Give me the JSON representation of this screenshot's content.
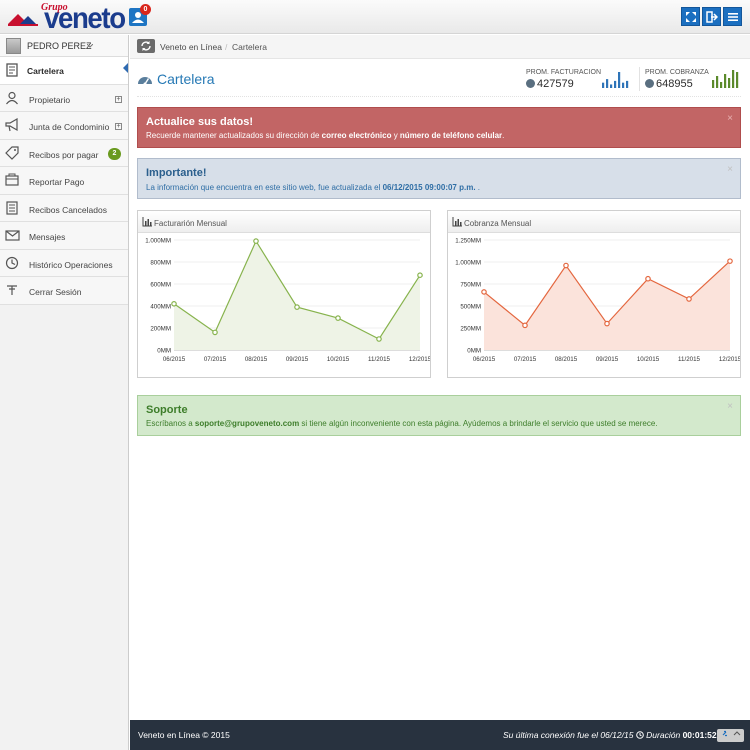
{
  "header": {
    "logo_small": "Grupo",
    "logo_main": "veneto",
    "notification_count": "0",
    "buttons": [
      "fullscreen-icon",
      "logout-icon",
      "menu-icon"
    ]
  },
  "sidebar": {
    "user_name": "PEDRO PEREZ",
    "items": [
      {
        "label": "Cartelera",
        "icon": "board-icon",
        "active": true
      },
      {
        "label": "Propietario",
        "icon": "user-icon",
        "toggle": "+"
      },
      {
        "label": "Junta de Condominio",
        "icon": "megaphone-icon",
        "toggle": "+"
      },
      {
        "label": "Recibos por pagar",
        "icon": "tags-icon",
        "badge": "2"
      },
      {
        "label": "Reportar Pago",
        "icon": "payment-icon"
      },
      {
        "label": "Recibos Cancelados",
        "icon": "receipts-icon"
      },
      {
        "label": "Mensajes",
        "icon": "envelope-icon"
      },
      {
        "label": "Histórico Operaciones",
        "icon": "clock-icon"
      },
      {
        "label": "Cerrar Sesión",
        "icon": "signout-icon"
      }
    ]
  },
  "breadcrumb": {
    "link": "Veneto en Línea",
    "separator": "/",
    "current": "Cartelera"
  },
  "page": {
    "title": "Cartelera",
    "stats": [
      {
        "title": "PROM. FACTURACION",
        "value": "427579",
        "bars": [
          3,
          5,
          2,
          4,
          9,
          3,
          4
        ],
        "color": "#2e74b8"
      },
      {
        "title": "PROM. COBRANZA",
        "value": "648955",
        "bars": [
          4,
          6,
          3,
          7,
          5,
          9,
          8
        ],
        "color": "#5b8a2b"
      }
    ]
  },
  "alerts": {
    "danger": {
      "title": "Actualice sus datos!",
      "text_1": "Recuerde mantener actualizados su dirección de ",
      "bold_1": "correo electrónico",
      "text_2": " y ",
      "bold_2": "número de teléfono celular",
      "text_3": "."
    },
    "info": {
      "title": "Importante!",
      "text_1": "La información que encuentra en este sitio web, fue actualizada el ",
      "bold_1": "06/12/2015 09:00:07 p.m.",
      "text_2": " ."
    },
    "success": {
      "title": "Soporte",
      "text_1": "Escríbanos a ",
      "bold_1": "soporte@grupoveneto.com",
      "text_2": " si tiene algún inconveniente con esta página. Ayúdemos a brindarle el servicio que usted se merece."
    },
    "close": "×"
  },
  "chart_data": [
    {
      "type": "area",
      "title": "Facturarión Mensual",
      "categories": [
        "06/2015",
        "07/2015",
        "08/2015",
        "09/2015",
        "10/2015",
        "11/2015",
        "12/2015"
      ],
      "values": [
        420,
        160,
        990,
        390,
        290,
        100,
        680
      ],
      "yticks": [
        "0MM",
        "200MM",
        "400MM",
        "600MM",
        "800MM",
        "1.000MM"
      ],
      "ylim": [
        0,
        1000
      ],
      "line_color": "#87b34d",
      "fill_color": "#eef3e6",
      "grid": true
    },
    {
      "type": "area",
      "title": "Cobranza Mensual",
      "categories": [
        "06/2015",
        "07/2015",
        "08/2015",
        "09/2015",
        "10/2015",
        "11/2015",
        "12/2015"
      ],
      "values": [
        660,
        280,
        960,
        300,
        810,
        580,
        1010
      ],
      "yticks": [
        "0MM",
        "250MM",
        "500MM",
        "750MM",
        "1.000MM",
        "1.250MM"
      ],
      "ylim": [
        0,
        1250
      ],
      "line_color": "#e4673f",
      "fill_color": "#fbe3db",
      "grid": true
    }
  ],
  "footer": {
    "left": "Veneto en Línea © 2015",
    "right_text": "Su última conexión fue el 06/12/15",
    "duration_label": "Duración",
    "duration_value": "00:01:52"
  }
}
